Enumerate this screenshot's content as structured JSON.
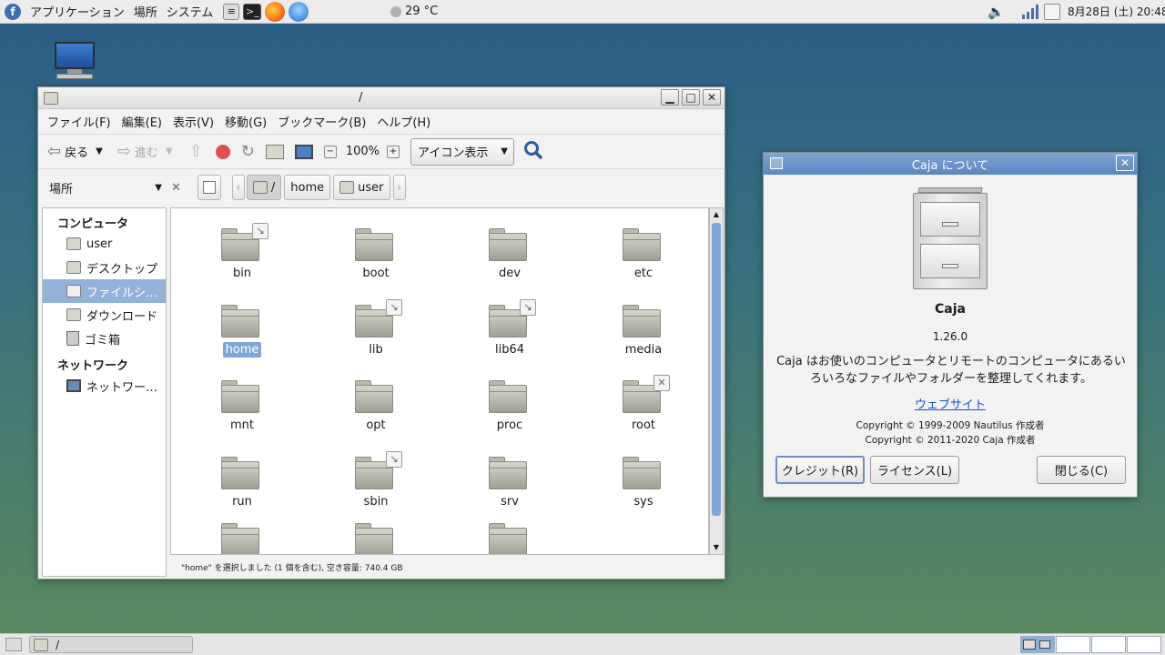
{
  "top_panel": {
    "menus": [
      "アプリケーション",
      "場所",
      "システム"
    ],
    "launchers": [
      "system-monitor-icon",
      "terminal-icon",
      "firefox-icon",
      "thunderbird-icon"
    ],
    "weather": "29 °C",
    "clock": "8月28日 (土) 20:48"
  },
  "desktop": {
    "icon": "computer-icon"
  },
  "bottom_panel": {
    "task_label": "/"
  },
  "file_manager": {
    "title": "/",
    "menus": [
      "ファイル(F)",
      "編集(E)",
      "表示(V)",
      "移動(G)",
      "ブックマーク(B)",
      "ヘルプ(H)"
    ],
    "back_label": "戻る",
    "forward_label": "進む",
    "zoom": "100%",
    "view_mode": "アイコン表示",
    "sidebar_mode": "場所",
    "breadcrumbs": [
      "/",
      "home",
      "user"
    ],
    "sidebar": {
      "computer_header": "コンピュータ",
      "network_header": "ネットワーク",
      "items": [
        "user",
        "デスクトップ",
        "ファイルシ…",
        "ダウンロード",
        "ゴミ箱"
      ],
      "network_items": [
        "ネットワー…"
      ]
    },
    "files": [
      "bin",
      "boot",
      "dev",
      "etc",
      "home",
      "lib",
      "lib64",
      "media",
      "mnt",
      "opt",
      "proc",
      "root",
      "run",
      "sbin",
      "srv",
      "sys"
    ],
    "status": "\"home\" を選択しました (1 個を含む), 空き容量: 740.4 GB"
  },
  "about": {
    "title": "Caja について",
    "app_name": "Caja",
    "version": "1.26.0",
    "description": "Caja はお使いのコンピュータとリモートのコンピュータにあるいろいろなファイルやフォルダーを整理してくれます。",
    "website": "ウェブサイト",
    "copyright1": "Copyright © 1999-2009 Nautilus 作成者",
    "copyright2": "Copyright © 2011-2020 Caja 作成者",
    "credits_button": "クレジット(R)",
    "license_button": "ライセンス(L)",
    "close_button": "閉じる(C)"
  }
}
